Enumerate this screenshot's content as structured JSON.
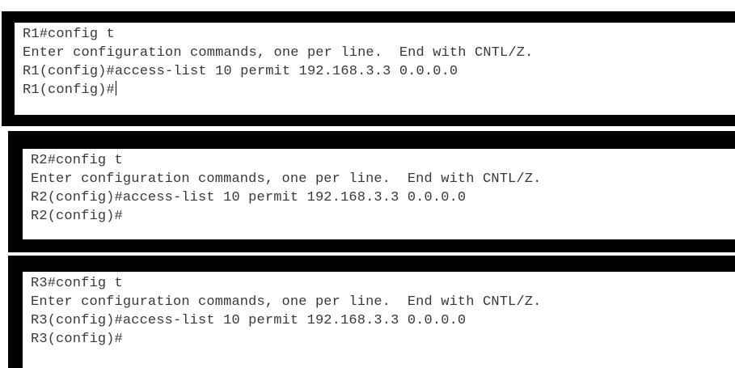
{
  "terminals": [
    {
      "device": "R1",
      "lines": [
        "R1#config t",
        "Enter configuration commands, one per line.  End with CNTL/Z.",
        "R1(config)#access-list 10 permit 192.168.3.3 0.0.0.0",
        "R1(config)#"
      ]
    },
    {
      "device": "R2",
      "lines": [
        "R2#config t",
        "Enter configuration commands, one per line.  End with CNTL/Z.",
        "R2(config)#access-list 10 permit 192.168.3.3 0.0.0.0",
        "R2(config)#"
      ]
    },
    {
      "device": "R3",
      "lines": [
        "R3#config t",
        "Enter configuration commands, one per line.  End with CNTL/Z.",
        "R3(config)#access-list 10 permit 192.168.3.3 0.0.0.0",
        "R3(config)#"
      ]
    }
  ]
}
